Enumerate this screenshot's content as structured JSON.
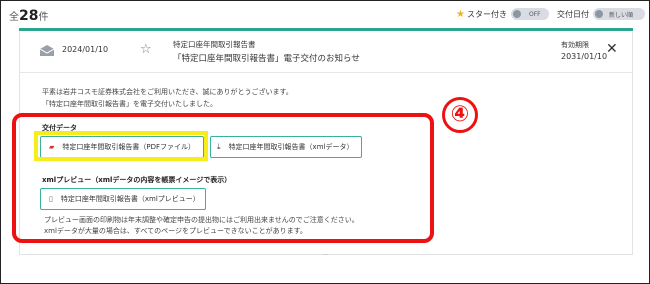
{
  "topbar": {
    "count_prefix": "全",
    "count_value": "28",
    "count_suffix": "件",
    "star_filter_label": "スター付き",
    "star_toggle_state": "OFF",
    "date_sort_label": "交付日付",
    "date_sort_value": "新しい順"
  },
  "document": {
    "date": "2024/01/10",
    "subject_line1": "特定口座年間取引報告書",
    "subject_line2": "「特定口座年間取引報告書」電子交付のお知らせ",
    "expiry_label": "有効期限",
    "expiry_date": "2031/01/10",
    "message_line1": "平素は岩井コスモ証券株式会社をご利用いただき、誠にありがとうございます。",
    "message_line2": "「特定口座年間取引報告書」を電子交付いたしました。",
    "delivery_section_title": "交付データ",
    "pdf_button_label": "特定口座年間取引報告書（PDFファイル）",
    "xml_button_label": "特定口座年間取引報告書（xmlデータ）",
    "preview_section_title": "xmlプレビュー（xmlデータの内容を帳票イメージで表示）",
    "preview_button_label": "特定口座年間取引報告書（xmlプレビュー）",
    "note_line1": "プレビュー画面の印刷物は年末調整や確定申告の提出物にはご利用出来ませんのでご注意ください。",
    "note_line2": "xmlデータが大量の場合は、すべてのページをプレビューできないことがあります。"
  },
  "annotation": {
    "callout_number": "④",
    "highlight_color": "#ee1111",
    "yellow_color": "#f8ed1b"
  },
  "colors": {
    "accent": "#2aa68e",
    "pdf_icon": "#d8322a",
    "star": "#f2b21c"
  }
}
